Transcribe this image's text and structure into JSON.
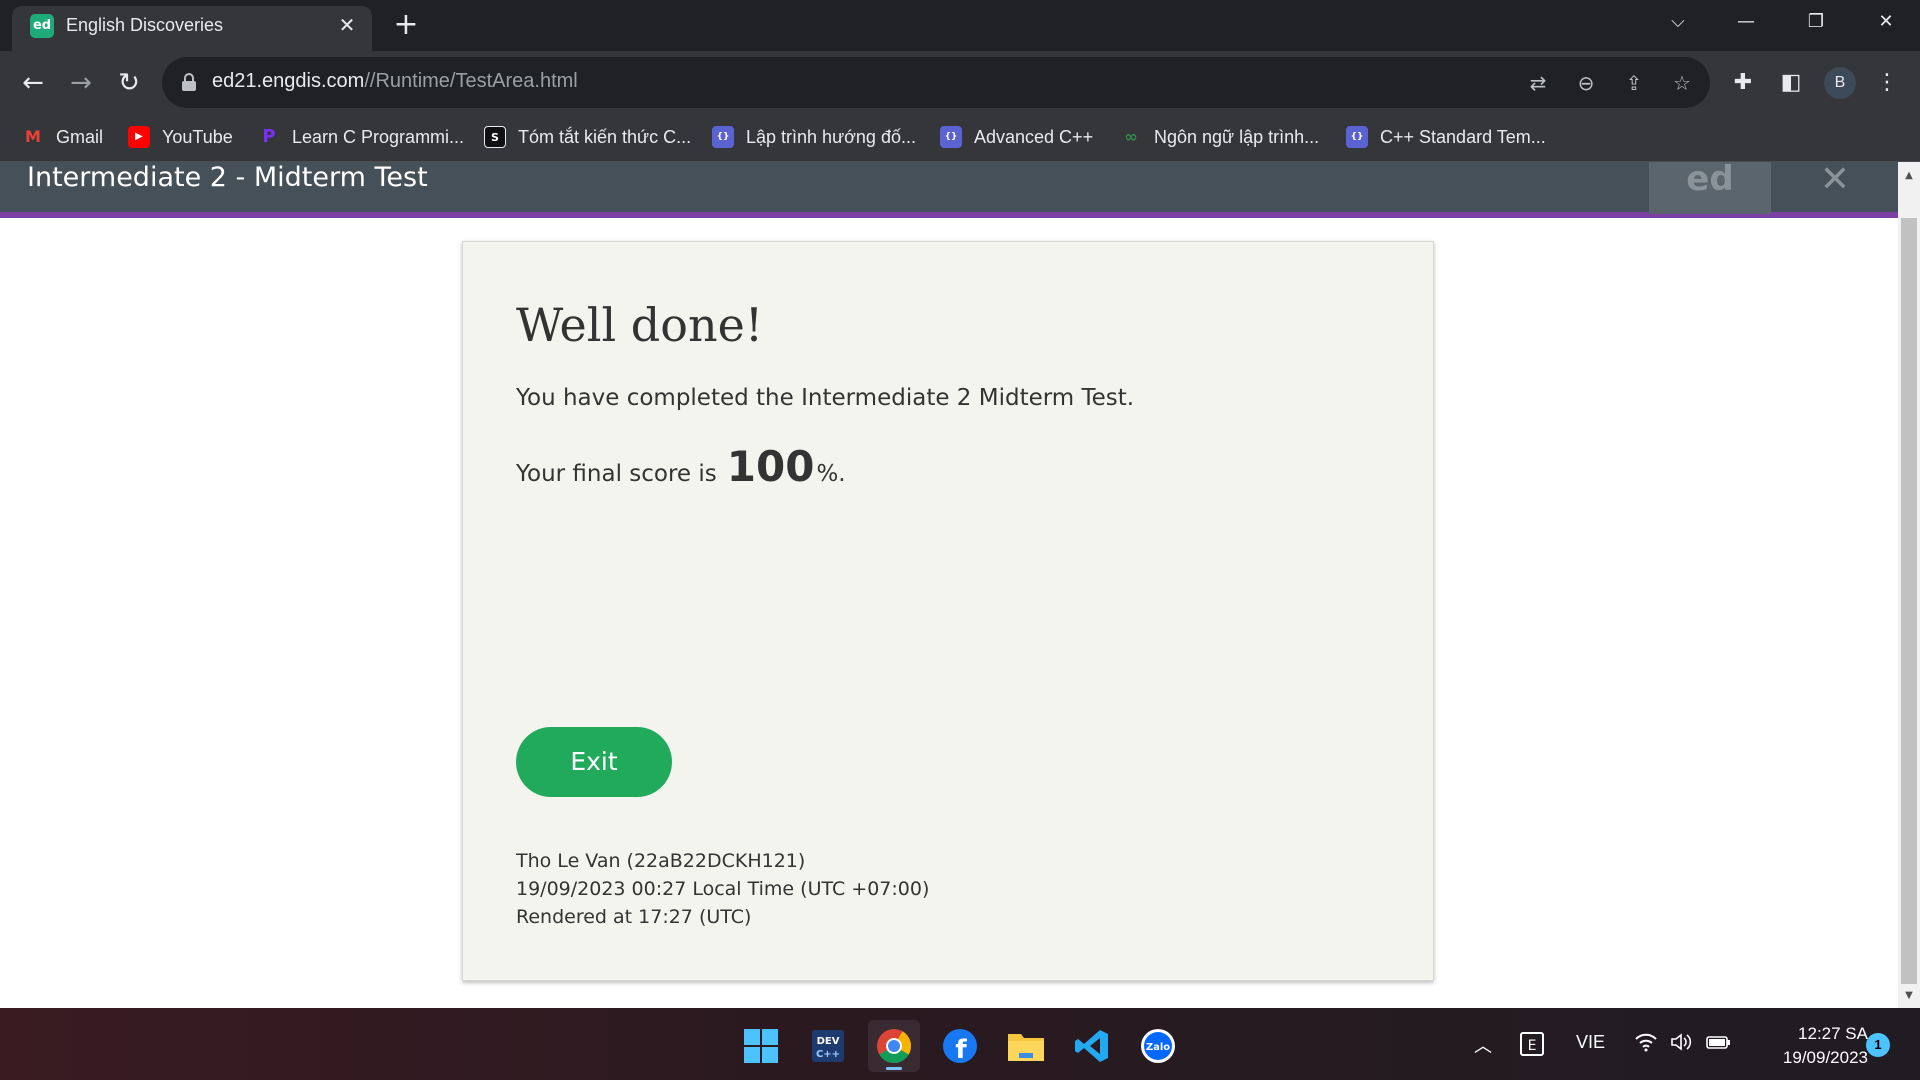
{
  "browser": {
    "tab_title": "English Discoveries",
    "tab_favicon_text": "ed",
    "url_host": "ed21.engdis.com",
    "url_path": "//Runtime/TestArea.html",
    "profile_initial": "B"
  },
  "bookmarks": [
    {
      "label": "Gmail",
      "icon": "gmail-icon",
      "color": "#ea4335",
      "glyph": "M"
    },
    {
      "label": "YouTube",
      "icon": "youtube-icon",
      "color": "#ff0000",
      "glyph": "▶"
    },
    {
      "label": "Learn C Programmi...",
      "icon": "bookmark-site-icon",
      "color": "#7b2ff7",
      "glyph": "P"
    },
    {
      "label": "Tóm tắt kiến thức C...",
      "icon": "bookmark-site-icon",
      "color": "#111111",
      "glyph": "S"
    },
    {
      "label": "Lập trình hướng đố...",
      "icon": "bookmark-site-icon",
      "color": "#5b63d3",
      "glyph": "{}"
    },
    {
      "label": "Advanced C++",
      "icon": "bookmark-site-icon",
      "color": "#5b63d3",
      "glyph": "{}"
    },
    {
      "label": "Ngôn ngữ lập trình...",
      "icon": "bookmark-site-icon",
      "color": "#2f8d46",
      "glyph": "∞"
    },
    {
      "label": "C++ Standard Tem...",
      "icon": "bookmark-site-icon",
      "color": "#5b63d3",
      "glyph": "{}"
    }
  ],
  "header": {
    "title": "Intermediate 2 - Midterm Test",
    "logo_text": "ed",
    "accent_color": "#7b3fa6"
  },
  "result": {
    "heading": "Well done!",
    "completed_text": "You have completed the Intermediate 2 Midterm Test.",
    "score_prefix": "Your final score is",
    "score_value": "100",
    "score_suffix": "%.",
    "exit_label": "Exit",
    "exit_color": "#22aa5c",
    "student_line": "Tho Le Van (22aB22DCKH121)",
    "local_time_line": "19/09/2023 00:27 Local Time (UTC +07:00)",
    "rendered_line": "Rendered at 17:27 (UTC)"
  },
  "taskbar": {
    "language": "VIE",
    "time": "12:27 SA",
    "date": "19/09/2023",
    "notification_count": "1"
  }
}
